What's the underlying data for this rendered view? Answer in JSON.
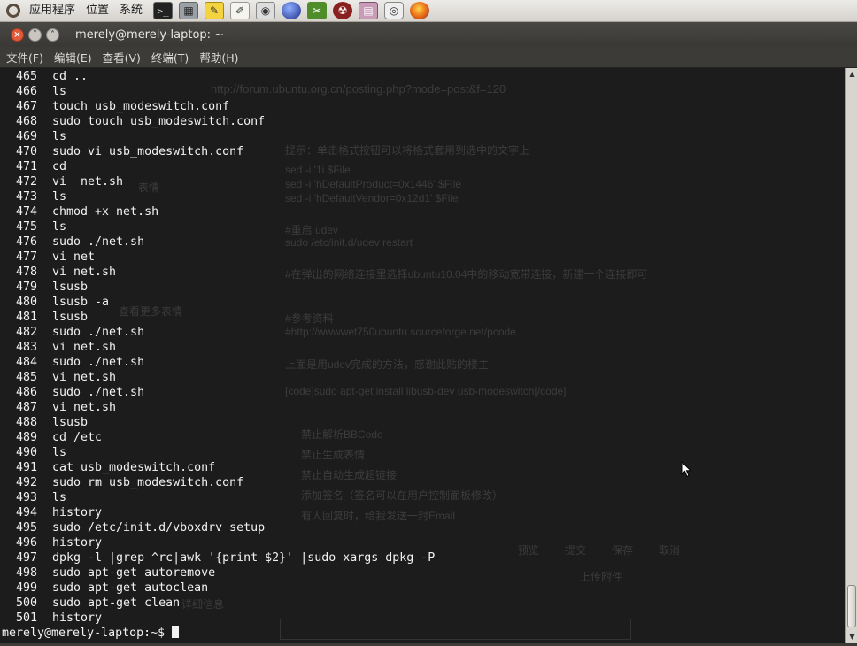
{
  "panel": {
    "menus": [
      "应用程序",
      "位置",
      "系统"
    ],
    "launchers": [
      {
        "icon": "terminal-icon",
        "glyph": ">_"
      },
      {
        "icon": "calculator-icon",
        "glyph": "▦"
      },
      {
        "icon": "notes-icon",
        "glyph": "✎"
      },
      {
        "icon": "text-editor-icon",
        "glyph": "✐"
      },
      {
        "icon": "camera-icon",
        "glyph": "◉"
      },
      {
        "icon": "globe-icon",
        "glyph": ""
      },
      {
        "icon": "tools-icon",
        "glyph": "✂"
      },
      {
        "icon": "bug-icon",
        "glyph": "☢"
      },
      {
        "icon": "disk-icon",
        "glyph": "▤"
      },
      {
        "icon": "speaker-icon",
        "glyph": "◎"
      },
      {
        "icon": "firefox-icon",
        "glyph": ""
      }
    ]
  },
  "window": {
    "title": "merely@merely-laptop: ~",
    "close_glyph": "×",
    "min_glyph": "˅",
    "max_glyph": "˄"
  },
  "menubar": [
    "文件(F)",
    "编辑(E)",
    "查看(V)",
    "终端(T)",
    "帮助(H)"
  ],
  "history": [
    {
      "num": "465",
      "cmd": "cd .."
    },
    {
      "num": "466",
      "cmd": "ls"
    },
    {
      "num": "467",
      "cmd": "touch usb_modeswitch.conf"
    },
    {
      "num": "468",
      "cmd": "sudo touch usb_modeswitch.conf"
    },
    {
      "num": "469",
      "cmd": "ls"
    },
    {
      "num": "470",
      "cmd": "sudo vi usb_modeswitch.conf"
    },
    {
      "num": "471",
      "cmd": "cd"
    },
    {
      "num": "472",
      "cmd": "vi  net.sh"
    },
    {
      "num": "473",
      "cmd": "ls"
    },
    {
      "num": "474",
      "cmd": "chmod +x net.sh"
    },
    {
      "num": "475",
      "cmd": "ls"
    },
    {
      "num": "476",
      "cmd": "sudo ./net.sh"
    },
    {
      "num": "477",
      "cmd": "vi net"
    },
    {
      "num": "478",
      "cmd": "vi net.sh"
    },
    {
      "num": "479",
      "cmd": "lsusb"
    },
    {
      "num": "480",
      "cmd": "lsusb -a"
    },
    {
      "num": "481",
      "cmd": "lsusb"
    },
    {
      "num": "482",
      "cmd": "sudo ./net.sh"
    },
    {
      "num": "483",
      "cmd": "vi net.sh"
    },
    {
      "num": "484",
      "cmd": "sudo ./net.sh"
    },
    {
      "num": "485",
      "cmd": "vi net.sh"
    },
    {
      "num": "486",
      "cmd": "sudo ./net.sh"
    },
    {
      "num": "487",
      "cmd": "vi net.sh"
    },
    {
      "num": "488",
      "cmd": "lsusb"
    },
    {
      "num": "489",
      "cmd": "cd /etc"
    },
    {
      "num": "490",
      "cmd": "ls"
    },
    {
      "num": "491",
      "cmd": "cat usb_modeswitch.conf"
    },
    {
      "num": "492",
      "cmd": "sudo rm usb_modeswitch.conf"
    },
    {
      "num": "493",
      "cmd": "ls"
    },
    {
      "num": "494",
      "cmd": "history"
    },
    {
      "num": "495",
      "cmd": "sudo /etc/init.d/vboxdrv setup"
    },
    {
      "num": "496",
      "cmd": "history"
    },
    {
      "num": "497",
      "cmd": "dpkg -l |grep ^rc|awk '{print $2}' |sudo xargs dpkg -P"
    },
    {
      "num": "498",
      "cmd": "sudo apt-get autoremove"
    },
    {
      "num": "499",
      "cmd": "sudo apt-get autoclean"
    },
    {
      "num": "500",
      "cmd": "sudo apt-get clean"
    },
    {
      "num": "501",
      "cmd": "history"
    }
  ],
  "prompt": "merely@merely-laptop:~$ ",
  "background_window": {
    "url": "http://forum.ubuntu.org.cn/posting.php?mode=post&f=120",
    "hint": "提示：单击格式按钮可以将格式套用到选中的文字上",
    "smilies": "表情",
    "more_smilies": "查看更多表情",
    "code_lines": [
      "sed -i '1i $File",
      "sed -i 'hDefaultProduct=0x1446' $File",
      "sed -i 'hDefaultVendor=0x12d1' $File",
      "#重启 udev",
      "sudo /etc/init.d/udev restart",
      "#在弹出的网络连接里选择ubuntu10.04中的移动宽带连接，新建一个连接即可",
      "#参考资料",
      "#http://wwwwet750ubuntu.sourceforge.net/pcode",
      "上面是用udev完成的方法，感谢此贴的楼主",
      "[code]sudo apt-get install libusb-dev usb-modeswitch[/code]"
    ],
    "options": [
      "禁止解析BBCode",
      "禁止生成表情",
      "禁止自动生成超链接",
      "添加签名（签名可以在用户控制面板修改）",
      "有人回复时，给我发送一封Email"
    ],
    "buttons": [
      "预览",
      "提交",
      "保存",
      "取消"
    ],
    "upload": "上传附件",
    "detail": "详细信息"
  }
}
